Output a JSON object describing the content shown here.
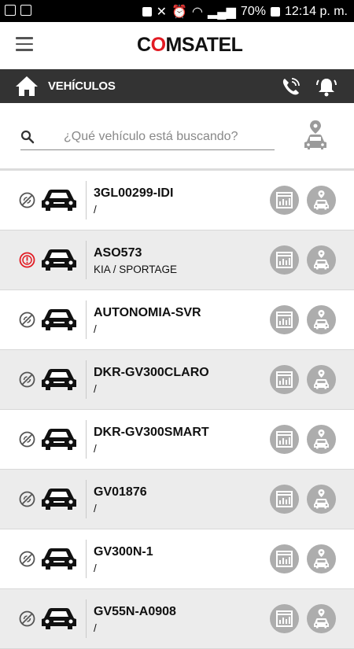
{
  "status_bar": {
    "battery": "70%",
    "time": "12:14 p. m."
  },
  "header": {
    "logo_pre": "C",
    "logo_o": "O",
    "logo_post": "MSATEL"
  },
  "section": {
    "title": "Vehículos"
  },
  "search": {
    "placeholder": "¿Qué vehículo está buscando?",
    "value": ""
  },
  "colors": {
    "section_bar": "#333333",
    "alert_red": "#e21b23",
    "action_button": "#adadad",
    "row_alt": "#ececec"
  },
  "vehicles": [
    {
      "name": "3GL00299-IDI",
      "sub": "/",
      "status": "no-signal-icon"
    },
    {
      "name": "ASO573",
      "sub": "KIA / SPORTAGE",
      "status": "alert-icon"
    },
    {
      "name": "AUTONOMIA-SVR",
      "sub": "/",
      "status": "no-signal-icon"
    },
    {
      "name": "DKR-GV300CLARO",
      "sub": "/",
      "status": "no-signal-icon"
    },
    {
      "name": "DKR-GV300SMART",
      "sub": "/",
      "status": "no-signal-icon"
    },
    {
      "name": "GV01876",
      "sub": "/",
      "status": "no-signal-icon"
    },
    {
      "name": "GV300N-1",
      "sub": "/",
      "status": "no-signal-icon"
    },
    {
      "name": "GV55N-A0908",
      "sub": "/",
      "status": "no-signal-icon"
    }
  ]
}
